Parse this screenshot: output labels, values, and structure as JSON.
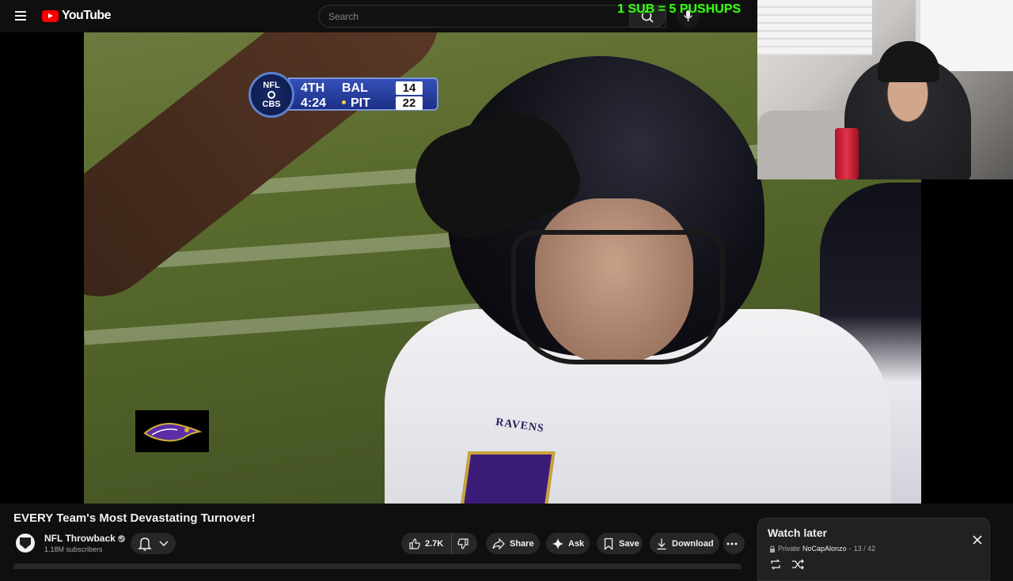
{
  "header": {
    "logo_text": "YouTube",
    "search_placeholder": "Search"
  },
  "overlay": {
    "promo_text": "1 SUB = 5 PUSHUPS"
  },
  "scorebug": {
    "network_top": "NFL",
    "network_bottom": "CBS",
    "quarter": "4TH",
    "clock": "4:24",
    "team1": "BAL",
    "score1": "14",
    "team2": "PIT",
    "score2": "22"
  },
  "video": {
    "title": "EVERY Team's Most Devastating Turnover!",
    "jersey_text": "RAVENS"
  },
  "channel": {
    "name": "NFL Throwback",
    "subscribers": "1.18M subscribers"
  },
  "actions": {
    "like_count": "2.7K",
    "share_label": "Share",
    "ask_label": "Ask",
    "save_label": "Save",
    "download_label": "Download"
  },
  "watch_later": {
    "title": "Watch later",
    "privacy": "Private",
    "owner": "NoCapAlonzo",
    "position": "13 / 42"
  },
  "colors": {
    "background": "#0f0f0f",
    "brand_red": "#ff0000",
    "pill_bg": "#272727",
    "overlay_green": "#39ff14",
    "ravens_purple": "#3a1c78"
  }
}
